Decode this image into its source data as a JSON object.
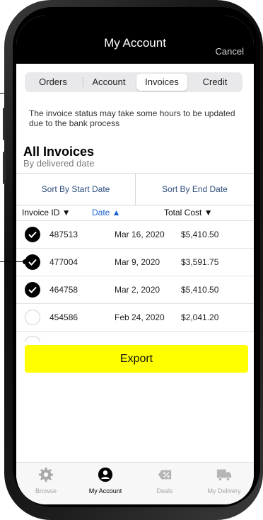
{
  "header": {
    "title": "My Account",
    "cancel_label": "Cancel"
  },
  "segments": [
    {
      "label": "Orders",
      "active": false
    },
    {
      "label": "Account",
      "active": false
    },
    {
      "label": "Invoices",
      "active": true
    },
    {
      "label": "Credit",
      "active": false
    }
  ],
  "notice": "The invoice status may take some hours to be updated due to the bank process",
  "invoices": {
    "title": "All Invoices",
    "subtitle": "By delivered date",
    "sort_start_label": "Sort By Start Date",
    "sort_end_label": "Sort By End Date",
    "columns": {
      "id": "Invoice ID ▼",
      "date": "Date ▲",
      "total": "Total Cost ▼"
    },
    "rows": [
      {
        "id": "487513",
        "date": "Mar 16, 2020",
        "total": "$5,410.50",
        "checked": true
      },
      {
        "id": "477004",
        "date": "Mar 9, 2020",
        "total": "$3,591.75",
        "checked": true
      },
      {
        "id": "464758",
        "date": "Mar 2, 2020",
        "total": "$5,410.50",
        "checked": true
      },
      {
        "id": "454586",
        "date": "Feb 24, 2020",
        "total": "$2,041.20",
        "checked": false
      }
    ]
  },
  "export_label": "Export",
  "tabs": [
    {
      "label": "Browse",
      "icon": "gear-icon",
      "active": false
    },
    {
      "label": "My Account",
      "icon": "user-icon",
      "active": true
    },
    {
      "label": "Deals",
      "icon": "discount-tag-icon",
      "active": false
    },
    {
      "label": "My Delivery",
      "icon": "truck-icon",
      "active": false
    }
  ],
  "colors": {
    "accent": "#ffff00",
    "header": "#000000",
    "link": "#2f4f7f",
    "sort_active": "#1a5fd0"
  }
}
